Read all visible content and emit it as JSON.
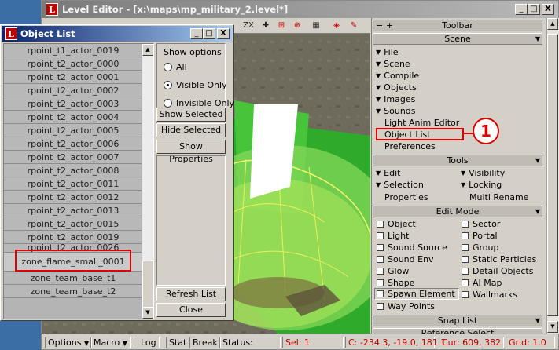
{
  "main_window": {
    "app_icon": "L",
    "title": "Level Editor - [x:\\maps\\mp_military_2.level*]",
    "caption_buttons": [
      "_",
      "□",
      "X"
    ]
  },
  "viewport_toolbar": {
    "zx_label": "ZX"
  },
  "right_panel": {
    "toolbar_header": "Toolbar",
    "toolbar_minus": "−",
    "toolbar_plus": "+",
    "scene_header": "Scene",
    "scene_items": [
      "File",
      "Scene",
      "Compile",
      "Objects",
      "Images",
      "Sounds"
    ],
    "scene_plain_items": [
      "Light Anim Editor",
      "Object List",
      "Preferences"
    ],
    "callout_number": "1",
    "tools_header": "Tools",
    "tools_items": [
      "Edit",
      "Visibility",
      "Selection",
      "Locking",
      "Properties",
      "Multi Rename"
    ],
    "edit_mode_header": "Edit Mode",
    "edit_mode_left": [
      "Object",
      "Light",
      "Sound Source",
      "Sound Env",
      "Glow",
      "Shape",
      "Spawn Element",
      "Way Points"
    ],
    "edit_mode_right": [
      "Sector",
      "Portal",
      "Group",
      "Static Particles",
      "Detail Objects",
      "AI Map",
      "Wallmarks"
    ],
    "snap_list_header": "Snap List",
    "reference_select_header": "Reference Select"
  },
  "statusbar": {
    "options": "Options",
    "macro": "Macro",
    "log": "Log",
    "stat": "Stat",
    "break": "Break",
    "status_label": "Status:",
    "sel": "Sel: 1",
    "coords": "C: -234.3, -19.0, 181.1",
    "cursor": "Cur: 609, 382",
    "grid": "Grid: 1.0"
  },
  "object_list": {
    "app_icon": "L",
    "title": "Object List",
    "caption_buttons": [
      "_",
      "□",
      "X"
    ],
    "items": [
      "rpoint_t1_actor_0019",
      "rpoint_t2_actor_0000",
      "rpoint_t2_actor_0001",
      "rpoint_t2_actor_0002",
      "rpoint_t2_actor_0003",
      "rpoint_t2_actor_0004",
      "rpoint_t2_actor_0005",
      "rpoint_t2_actor_0006",
      "rpoint_t2_actor_0007",
      "rpoint_t2_actor_0008",
      "rpoint_t2_actor_0011",
      "rpoint_t2_actor_0012",
      "rpoint_t2_actor_0013",
      "rpoint_t2_actor_0015",
      "rpoint_t2_actor_0019",
      "rpoint_t2_actor_0026",
      "zone_flame_small_0001",
      "zone_team_base_t1",
      "zone_team_base_t2"
    ],
    "show_options_title": "Show options",
    "show_options": [
      {
        "label": "All",
        "checked": false
      },
      {
        "label": "Visible Only",
        "checked": true
      },
      {
        "label": "Invisible Only",
        "checked": false
      }
    ],
    "show_selected": "Show Selected",
    "hide_selected": "Hide Selected",
    "show_properties": "Show Properties",
    "refresh_list": "Refresh List",
    "close": "Close"
  },
  "colors": {
    "highlight_red": "#e00000",
    "title_active": "#0a246a",
    "title_inactive": "#808080"
  }
}
